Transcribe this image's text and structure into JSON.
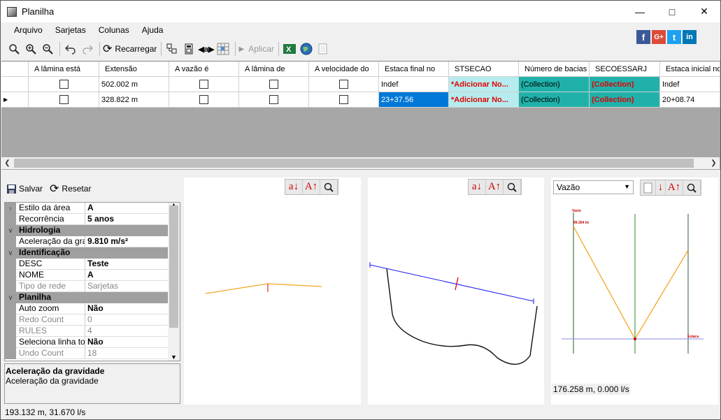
{
  "window": {
    "title": "Planilha"
  },
  "menu": [
    "Arquivo",
    "Sarjetas",
    "Colunas",
    "Ajuda"
  ],
  "toolbar": {
    "reload_label": "Recarregar",
    "apply_label": "Aplicar"
  },
  "social": [
    "f",
    "G+",
    "t",
    "in"
  ],
  "grid": {
    "columns": [
      "",
      "A lâmina está",
      "Extensão",
      "A vazão é",
      "A lâmina de",
      "A velocidade do",
      "Estaca final no",
      "STSECAO",
      "Número de bacias",
      "SECOESSARJ",
      "Estaca inicial no"
    ],
    "rows": [
      {
        "extensao": "502.002 m",
        "estaca_final": "Indef",
        "stsecao": "*Adicionar No...",
        "bacias": "(Collection)",
        "secoes": "(Collection)",
        "estaca_inicial": "Indef"
      },
      {
        "extensao": "328.822 m",
        "estaca_final": "23+37.56",
        "stsecao": "*Adicionar No...",
        "bacias": "(Collection)",
        "secoes": "(Collection)",
        "estaca_inicial": "20+08.74"
      }
    ]
  },
  "left_toolbar": {
    "save_label": "Salvar",
    "reset_label": "Resetar"
  },
  "properties": [
    {
      "type": "prop",
      "key": "Estilo da área",
      "value": "A"
    },
    {
      "type": "prop",
      "key": "Recorrência",
      "value": "5 anos"
    },
    {
      "type": "cat",
      "key": "Hidrologia"
    },
    {
      "type": "prop",
      "key": "Aceleração da gravidade",
      "value": "9.810 m/s²"
    },
    {
      "type": "cat",
      "key": "Identificação"
    },
    {
      "type": "prop",
      "key": "DESC",
      "value": "Teste"
    },
    {
      "type": "prop",
      "key": "NOME",
      "value": "A"
    },
    {
      "type": "dis",
      "key": "Tipo de rede",
      "value": "Sarjetas"
    },
    {
      "type": "cat",
      "key": "Planilha"
    },
    {
      "type": "prop",
      "key": "Auto zoom",
      "value": "Não"
    },
    {
      "type": "dis",
      "key": "Redo Count",
      "value": "0"
    },
    {
      "type": "dis",
      "key": "RULES",
      "value": "4"
    },
    {
      "type": "prop",
      "key": "Seleciona linha todo",
      "value": "Não"
    },
    {
      "type": "dis",
      "key": "Undo Count",
      "value": "18"
    }
  ],
  "description": {
    "title": "Aceleração da gravidade",
    "text": "Aceleração da gravidade"
  },
  "pane_tools": [
    "a↓",
    "A↑",
    "🔍"
  ],
  "right_pane": {
    "dropdown": "Vazão",
    "label_top": "Vazio",
    "label_value": "99.304 l/s",
    "label_estaca": "Estaca",
    "readout": "176.258 m, 0.000 l/s"
  },
  "status": "193.132 m, 31.670 l/s",
  "colors": {
    "teal": "#20b2aa",
    "cyan": "#b6ecee",
    "selection": "#0078d7",
    "error_text": "#e00000"
  }
}
